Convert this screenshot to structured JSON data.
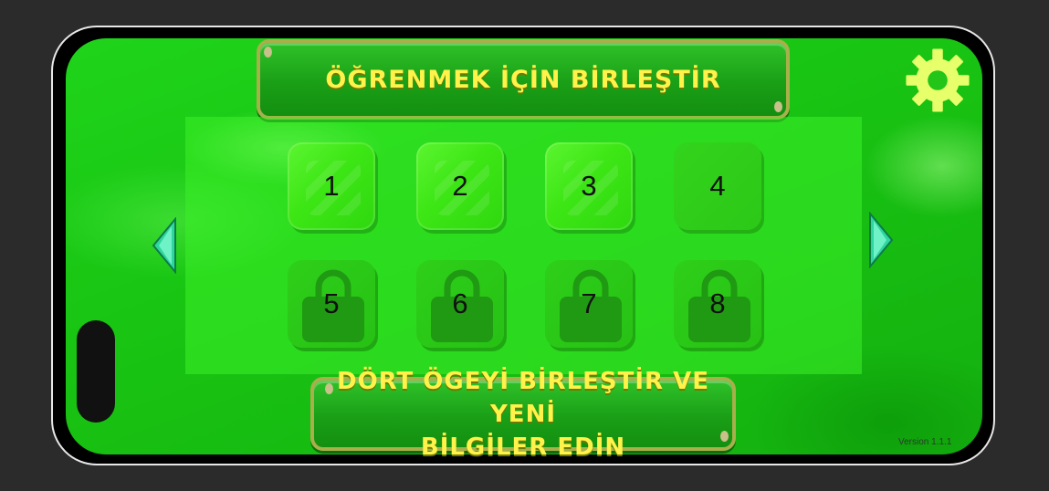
{
  "title": "ÖĞRENMEK İÇİN BİRLEŞTİR",
  "info_line1": "DÖRT ÖGEYİ BİRLEŞTİR VE YENİ",
  "info_line2": "BİLGİLER EDİN",
  "version": "Version 1.1.1",
  "icons": {
    "settings": "gear-icon",
    "prev": "chevron-left-icon",
    "next": "chevron-right-icon",
    "lock": "lock-icon"
  },
  "colors": {
    "title_text": "#fff24a",
    "background": "#19c513",
    "tile": "#3de615"
  },
  "levels": [
    {
      "label": "1",
      "locked": false
    },
    {
      "label": "2",
      "locked": false
    },
    {
      "label": "3",
      "locked": false
    },
    {
      "label": "4",
      "locked": false
    },
    {
      "label": "5",
      "locked": true
    },
    {
      "label": "6",
      "locked": true
    },
    {
      "label": "7",
      "locked": true
    },
    {
      "label": "8",
      "locked": true
    }
  ]
}
